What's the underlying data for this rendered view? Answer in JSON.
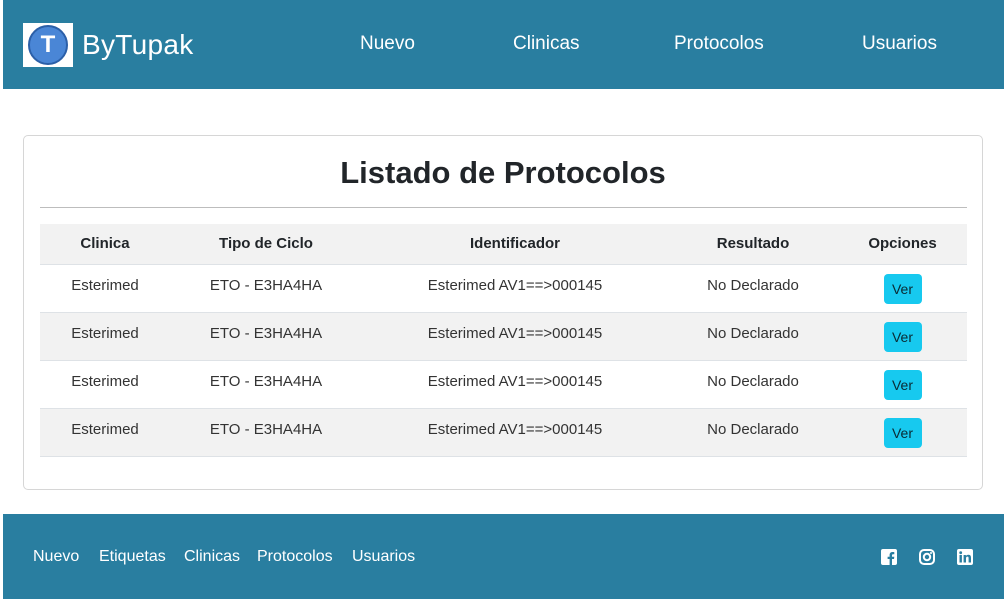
{
  "header": {
    "logo_letter": "T",
    "brand": "ByTupak",
    "nav": [
      "Nuevo",
      "Clinicas",
      "Protocolos",
      "Usuarios"
    ]
  },
  "main": {
    "title": "Listado de Protocolos",
    "table": {
      "headers": [
        "Clinica",
        "Tipo de Ciclo",
        "Identificador",
        "Resultado",
        "Opciones"
      ],
      "rows": [
        [
          "Esterimed",
          "ETO - E3HA4HA",
          "Esterimed AV1==>000145",
          "No Declarado",
          "Ver"
        ],
        [
          "Esterimed",
          "ETO - E3HA4HA",
          "Esterimed AV1==>000145",
          "No Declarado",
          "Ver"
        ],
        [
          "Esterimed",
          "ETO - E3HA4HA",
          "Esterimed AV1==>000145",
          "No Declarado",
          "Ver"
        ],
        [
          "Esterimed",
          "ETO - E3HA4HA",
          "Esterimed AV1==>000145",
          "No Declarado",
          "Ver"
        ]
      ]
    }
  },
  "footer": {
    "links": [
      "Nuevo",
      "Etiquetas",
      "Clinicas",
      "Protocolos",
      "Usuarios"
    ],
    "social": [
      "facebook-icon",
      "instagram-icon",
      "linkedin-icon"
    ]
  },
  "colors": {
    "brand_bar": "#297ea0",
    "button": "#17c9ef",
    "stripe": "#f2f2f2"
  }
}
